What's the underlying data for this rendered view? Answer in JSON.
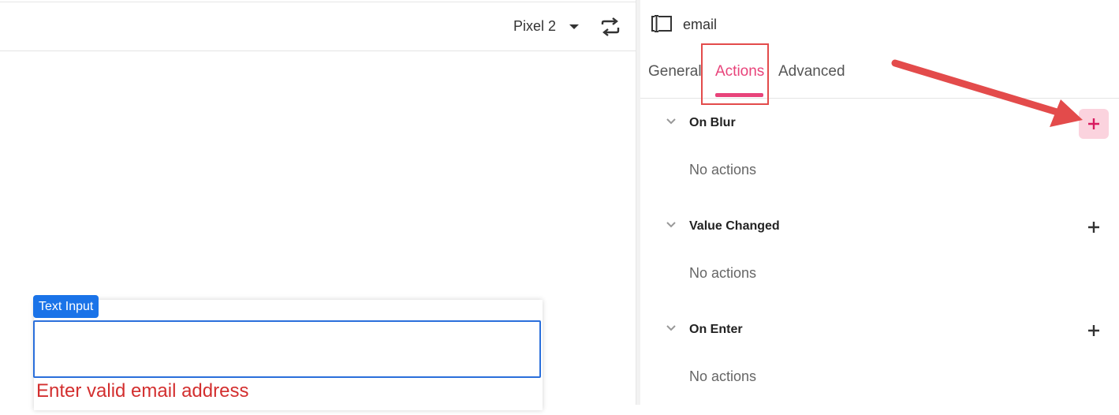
{
  "canvas": {
    "device": "Pixel 2",
    "widget_tag": "Text Input",
    "input_value": "",
    "error_message": "Enter valid email address"
  },
  "panel": {
    "widget_name": "email",
    "tabs": [
      {
        "label": "General"
      },
      {
        "label": "Actions"
      },
      {
        "label": "Advanced"
      }
    ],
    "sections": [
      {
        "title": "On Blur",
        "empty_text": "No actions"
      },
      {
        "title": "Value Changed",
        "empty_text": "No actions"
      },
      {
        "title": "On Enter",
        "empty_text": "No actions"
      }
    ]
  },
  "icons": {
    "device_dropdown": "caret-down-icon",
    "rotate": "rotate-icon",
    "widget": "text-input-icon",
    "section_toggle": "chevron-down-icon",
    "add": "plus-icon"
  },
  "colors": {
    "accent": "#e8437a",
    "selection_blue": "#1a73e8",
    "error": "#d32f2f",
    "annotation": "#e34b4b"
  }
}
